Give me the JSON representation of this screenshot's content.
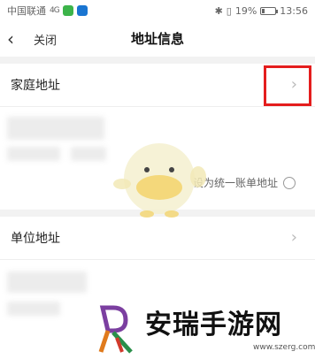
{
  "status_bar": {
    "carrier": "中国联通",
    "signal": "4G",
    "bt_icon": "bluetooth-icon",
    "mute_icon": "vibrate-icon",
    "battery_percent": "19%",
    "battery_level": 0.19,
    "time": "13:56"
  },
  "nav": {
    "back_icon": "chevron-left-icon",
    "close_label": "关闭",
    "title": "地址信息"
  },
  "home_address": {
    "label": "家庭地址",
    "chevron_icon": "chevron-right-icon"
  },
  "bill_option": {
    "label": "设为统一账单地址",
    "checked": false
  },
  "work_address": {
    "label": "单位地址",
    "chevron_icon": "chevron-right-icon"
  },
  "watermark": {
    "title": "安瑞手游网",
    "url": "www.szerg.com"
  },
  "colors": {
    "highlight": "#e41d1d",
    "background": "#f2f2f2",
    "card": "#ffffff"
  }
}
